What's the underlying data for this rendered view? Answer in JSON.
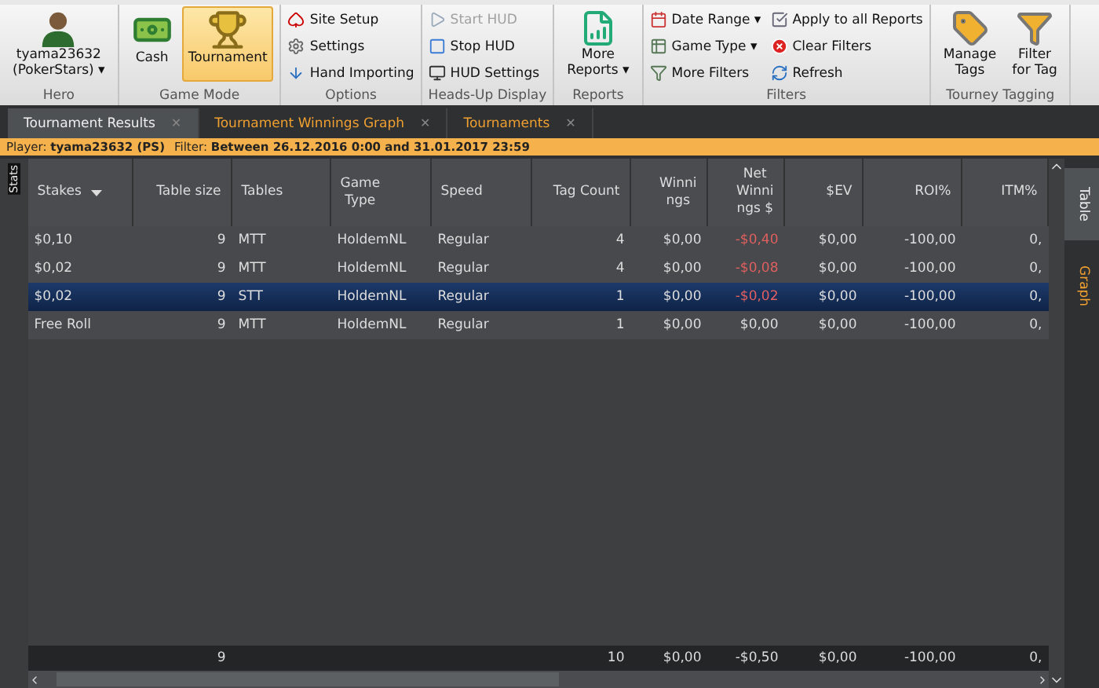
{
  "ribbon": {
    "groups": [
      {
        "label": "Hero",
        "kind": "hero",
        "items": [
          {
            "label": "tyama23632\n(PokerStars) ▾"
          }
        ]
      },
      {
        "label": "Game Mode",
        "kind": "big",
        "items": [
          {
            "label": "Cash",
            "selected": false
          },
          {
            "label": "Tournament",
            "selected": true
          }
        ]
      },
      {
        "label": "Options",
        "kind": "small",
        "items": [
          {
            "label": "Site Setup",
            "disabled": false
          },
          {
            "label": "Settings",
            "disabled": false
          },
          {
            "label": "Hand Importing",
            "disabled": false
          }
        ]
      },
      {
        "label": "Heads-Up Display",
        "kind": "small",
        "items": [
          {
            "label": "Start HUD",
            "disabled": true
          },
          {
            "label": "Stop HUD",
            "disabled": false
          },
          {
            "label": "HUD Settings",
            "disabled": false
          }
        ]
      },
      {
        "label": "Reports",
        "kind": "big",
        "items": [
          {
            "label": "More\nReports ▾",
            "selected": false
          }
        ]
      },
      {
        "label": "Filters",
        "kind": "small",
        "items": [
          {
            "label": "Date Range ▾",
            "disabled": false
          },
          {
            "label": "Game Type ▾",
            "disabled": false
          },
          {
            "label": "More Filters",
            "disabled": false
          },
          {
            "label": "Apply to all Reports",
            "disabled": false
          },
          {
            "label": "Clear Filters",
            "disabled": false
          },
          {
            "label": "Refresh",
            "disabled": false
          }
        ]
      },
      {
        "label": "Tourney Tagging",
        "kind": "big",
        "items": [
          {
            "label": "Manage\nTags",
            "selected": false
          },
          {
            "label": "Filter\nfor Tag",
            "selected": false
          }
        ]
      }
    ]
  },
  "tabs": [
    {
      "label": "Tournament Results",
      "close": "✕",
      "selected": true
    },
    {
      "label": "Tournament Winnings Graph",
      "close": "✕",
      "selected": false
    },
    {
      "label": "Tournaments",
      "close": "✕",
      "selected": false
    }
  ],
  "info_bar": {
    "player_label": "Player:",
    "player": "tyama23632 (PS)",
    "filter_label": "Filter:",
    "filter": "Between 26.12.2016 0:00 and 31.01.2017 23:59"
  },
  "left_tab": "Stats",
  "side_tabs": [
    {
      "label": "Table",
      "selected": true
    },
    {
      "label": "Graph",
      "selected": false
    }
  ],
  "table": {
    "columns": [
      "Stakes",
      "Table size",
      "Tables",
      "Game\nType",
      "Speed",
      "Tag Count",
      "Winni\nngs",
      "Net\nWinni\nngs $",
      "$EV",
      "ROI%",
      "ITM%"
    ],
    "rows": [
      {
        "selected": false,
        "cells": [
          "$0,10",
          "9",
          "MTT",
          "HoldemNL",
          "Regular",
          "4",
          "$0,00",
          "-$0,40",
          "$0,00",
          "-100,00",
          "0,"
        ],
        "negative_net": true
      },
      {
        "selected": false,
        "cells": [
          "$0,02",
          "9",
          "MTT",
          "HoldemNL",
          "Regular",
          "4",
          "$0,00",
          "-$0,08",
          "$0,00",
          "-100,00",
          "0,"
        ],
        "negative_net": true
      },
      {
        "selected": true,
        "cells": [
          "$0,02",
          "9",
          "STT",
          "HoldemNL",
          "Regular",
          "1",
          "$0,00",
          "-$0,02",
          "$0,00",
          "-100,00",
          "0,"
        ],
        "negative_net": true
      },
      {
        "selected": false,
        "cells": [
          "Free Roll",
          "9",
          "MTT",
          "HoldemNL",
          "Regular",
          "1",
          "$0,00",
          "$0,00",
          "$0,00",
          "-100,00",
          "0,"
        ],
        "negative_net": false
      }
    ],
    "totals": {
      "table_size": "9",
      "tag_count": "10",
      "winnings": "$0,00",
      "net_winnings": "-$0,50",
      "ev": "$0,00",
      "roi": "-100,00",
      "itm": "0,"
    }
  }
}
